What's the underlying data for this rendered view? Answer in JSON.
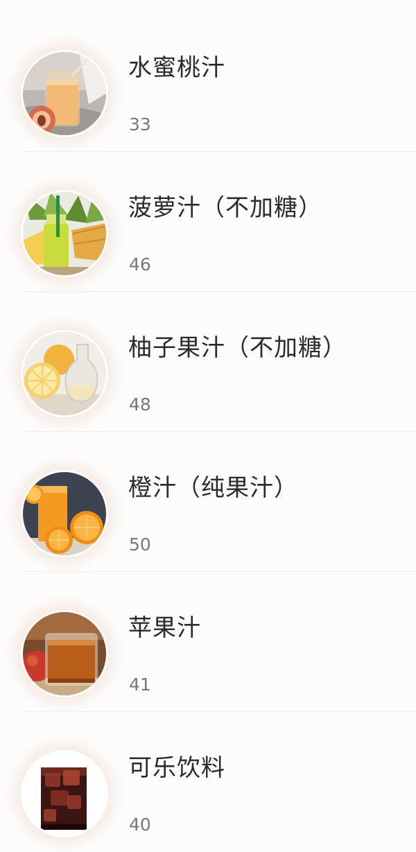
{
  "drinks": [
    {
      "name": "水蜜桃汁",
      "value": "33",
      "image": "peach-juice-image"
    },
    {
      "name": "菠萝汁（不加糖）",
      "value": "46",
      "image": "pineapple-juice-image"
    },
    {
      "name": "柚子果汁（不加糖）",
      "value": "48",
      "image": "grapefruit-juice-image"
    },
    {
      "name": "橙汁（纯果汁）",
      "value": "50",
      "image": "orange-juice-image"
    },
    {
      "name": "苹果汁",
      "value": "41",
      "image": "apple-juice-image"
    },
    {
      "name": "可乐饮料",
      "value": "40",
      "image": "cola-drink-image"
    }
  ]
}
